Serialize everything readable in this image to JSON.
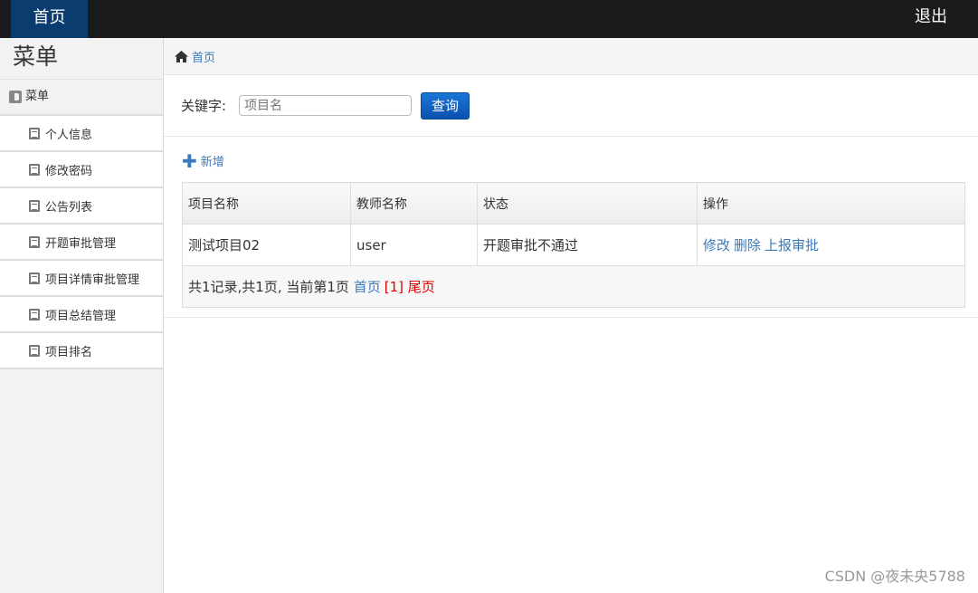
{
  "topbar": {
    "home": "首页",
    "logout": "退出"
  },
  "sidebar": {
    "title": "菜单",
    "header": "菜单",
    "items": [
      "个人信息",
      "修改密码",
      "公告列表",
      "开题审批管理",
      "项目详情审批管理",
      "项目总结管理",
      "项目排名"
    ]
  },
  "breadcrumb": {
    "home": "首页"
  },
  "search": {
    "label": "关键字:",
    "placeholder": "项目名",
    "button": "查询"
  },
  "add_label": "新增",
  "table": {
    "headers": [
      "项目名称",
      "教师名称",
      "状态",
      "操作"
    ],
    "rows": [
      {
        "name": "测试项目02",
        "teacher": "user",
        "status": "开题审批不通过",
        "actions": [
          "修改",
          "删除",
          "上报审批"
        ]
      }
    ],
    "pager": {
      "summary": "共1记录,共1页, 当前第1页",
      "first": "首页",
      "current": "[1]",
      "last": "尾页"
    }
  },
  "watermark": "CSDN @夜未央5788"
}
